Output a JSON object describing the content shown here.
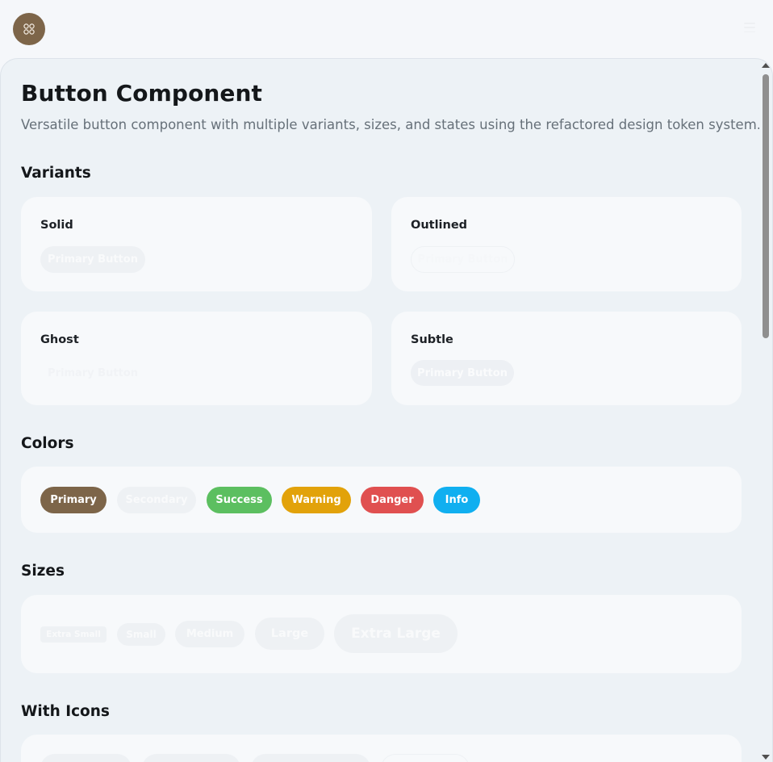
{
  "header": {
    "logo_icon": "grid-apps-icon",
    "menu_icon": "hamburger-menu-icon"
  },
  "page": {
    "title": "Button Component",
    "description": "Versatile button component with multiple variants, sizes, and states using the refactored design token system."
  },
  "sections": {
    "variants": {
      "title": "Variants",
      "cards": [
        {
          "title": "Solid",
          "button_label": "Primary Button"
        },
        {
          "title": "Outlined",
          "button_label": "Primary Button"
        },
        {
          "title": "Ghost",
          "button_label": "Primary Button"
        },
        {
          "title": "Subtle",
          "button_label": "Primary Button"
        }
      ]
    },
    "colors": {
      "title": "Colors",
      "buttons": [
        {
          "label": "Primary",
          "color": "#7d6549"
        },
        {
          "label": "Secondary",
          "color": "#eef1f4"
        },
        {
          "label": "Success",
          "color": "#5cbf60"
        },
        {
          "label": "Warning",
          "color": "#e2a20a"
        },
        {
          "label": "Danger",
          "color": "#e05050"
        },
        {
          "label": "Info",
          "color": "#10aff0"
        }
      ]
    },
    "sizes": {
      "title": "Sizes",
      "buttons": [
        {
          "label": "Extra Small"
        },
        {
          "label": "Small"
        },
        {
          "label": "Medium"
        },
        {
          "label": "Large"
        },
        {
          "label": "Extra Large"
        }
      ]
    },
    "with_icons": {
      "title": "With Icons"
    }
  }
}
